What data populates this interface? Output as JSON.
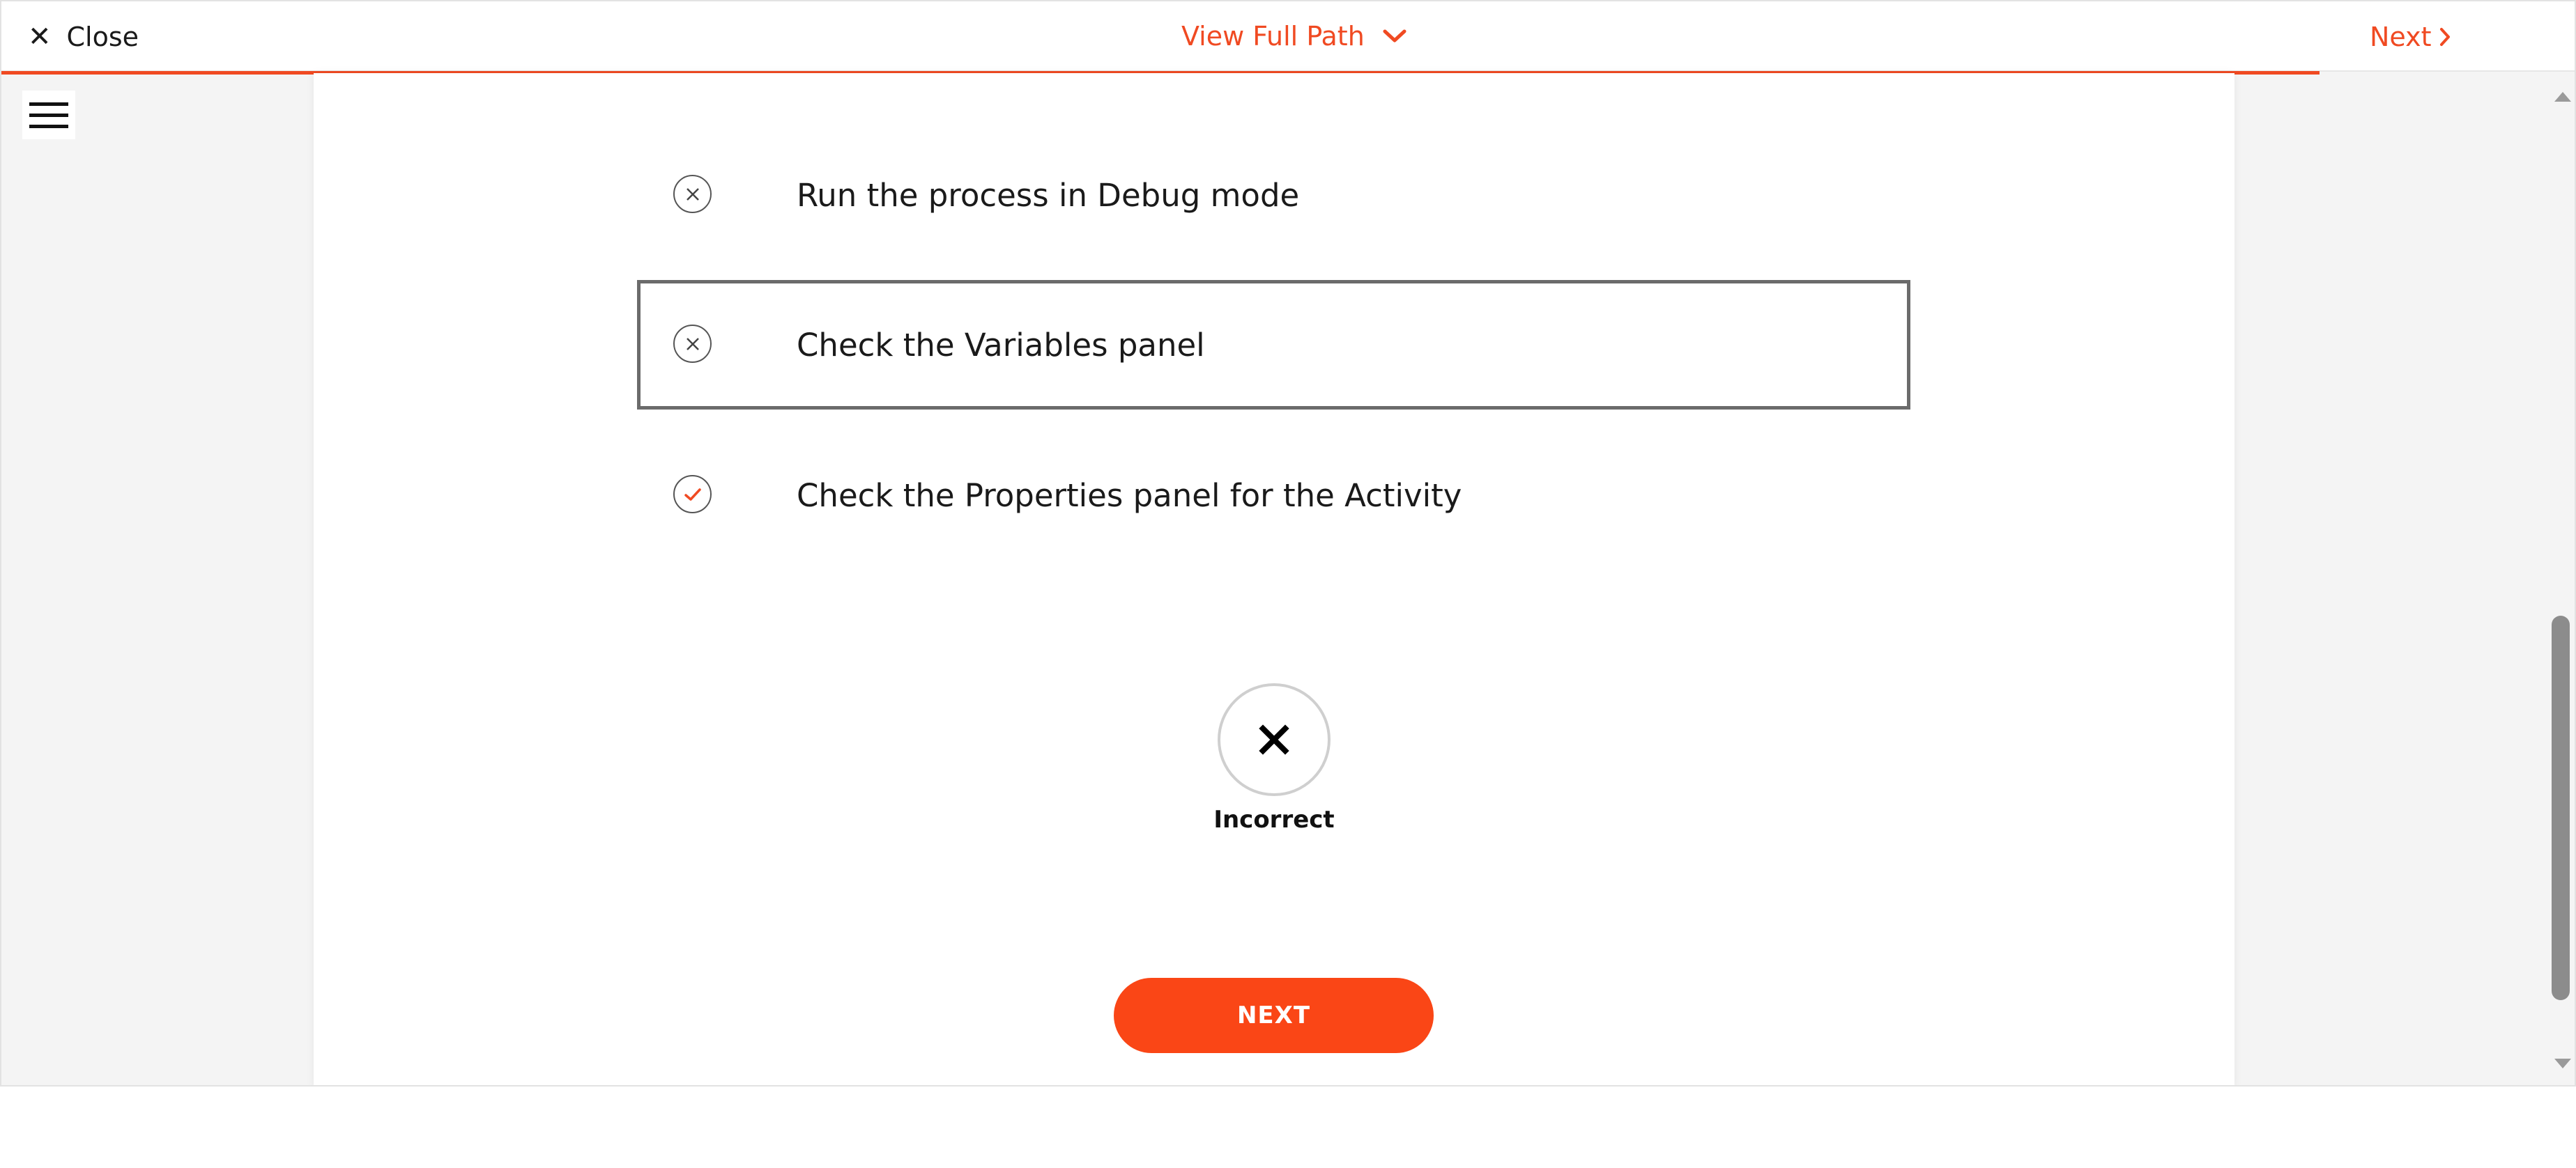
{
  "topbar": {
    "close_label": "Close",
    "close_icon": "✕",
    "path_label": "View Full Path",
    "next_label": "Next",
    "accent": "#f04a22"
  },
  "question": {
    "options": [
      {
        "label": "Run the process in Debug mode",
        "state": "incorrect",
        "selected": false
      },
      {
        "label": "Check the Variables panel",
        "state": "incorrect",
        "selected": true
      },
      {
        "label": "Check the Properties panel for the Activity",
        "state": "correct",
        "selected": false
      }
    ]
  },
  "result": {
    "icon": "✕",
    "label": "Incorrect"
  },
  "footer": {
    "next_button": "NEXT",
    "button_color": "#fa4616"
  }
}
